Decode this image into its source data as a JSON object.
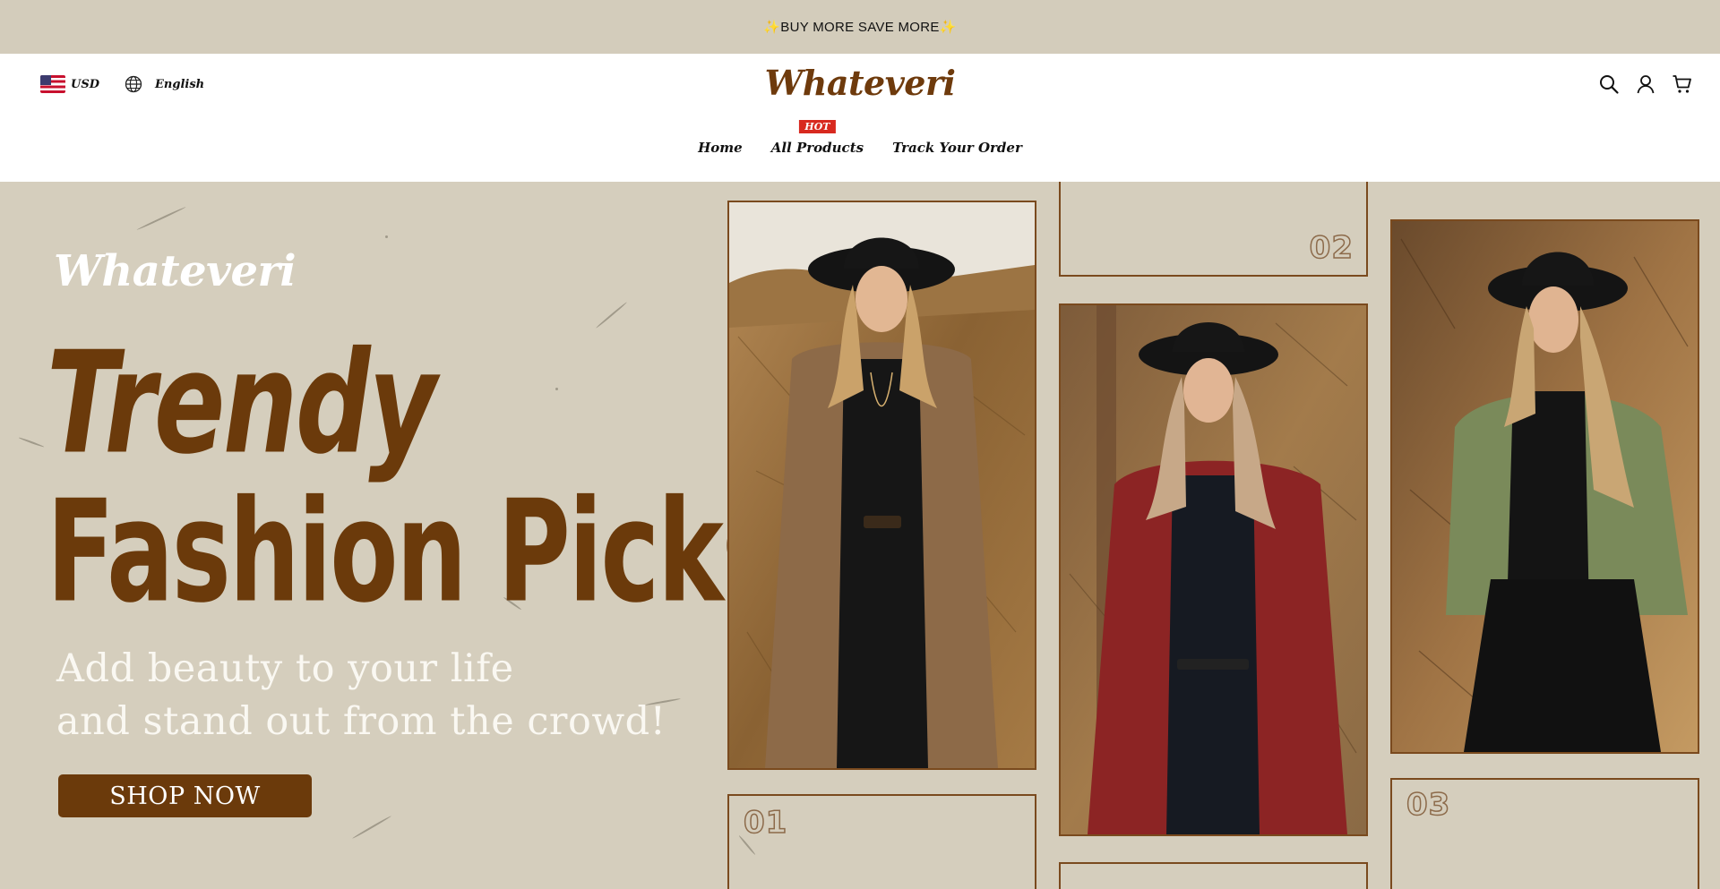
{
  "announcement": {
    "text": "BUY MORE SAVE MORE",
    "spark_left": "✨",
    "spark_right": "✨"
  },
  "header": {
    "currency": "USD",
    "language": "English",
    "logo": "Whateveri",
    "nav": [
      {
        "label": "Home"
      },
      {
        "label": "All Products",
        "badge": "HOT"
      },
      {
        "label": "Track Your Order"
      }
    ],
    "icons": [
      "search-icon",
      "account-icon",
      "cart-icon"
    ]
  },
  "hero": {
    "brand": "Whateveri",
    "headline_line1": "Trendy",
    "headline_line2": "Fashion Picks",
    "sub_line1": "Add beauty to your life",
    "sub_line2": "and stand out from the crowd!",
    "cta": "SHOP NOW",
    "numbers": [
      "01",
      "02",
      "03"
    ]
  },
  "colors": {
    "brand_brown": "#6b3a0b",
    "hero_bg": "#d5cebd",
    "hot_badge": "#d8291f",
    "frame_border": "#7a4a1e"
  }
}
